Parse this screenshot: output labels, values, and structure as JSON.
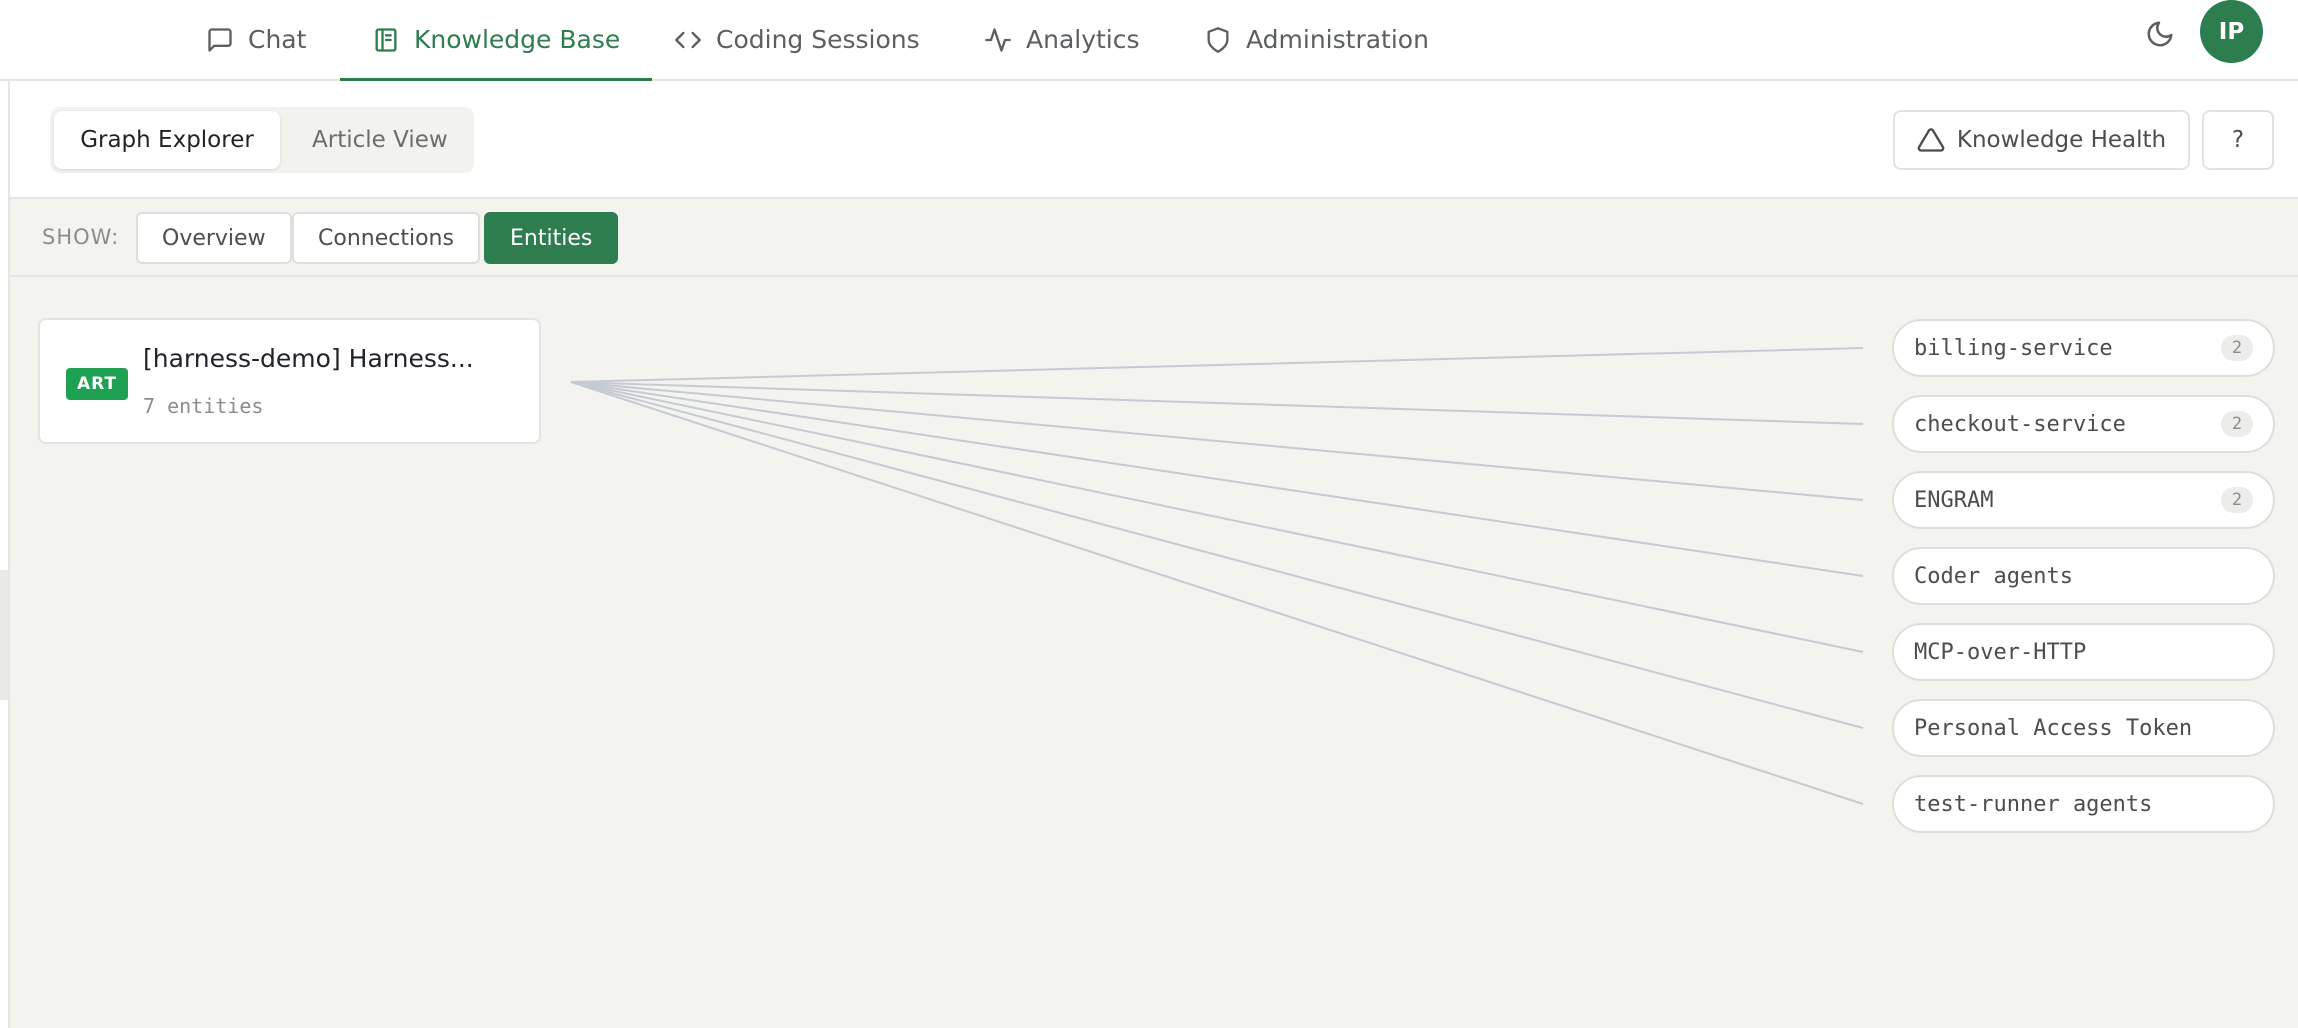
{
  "nav": {
    "tabs": [
      {
        "label": "Chat",
        "icon": "message-square-icon",
        "active": false
      },
      {
        "label": "Knowledge Base",
        "icon": "book-open-icon",
        "active": true
      },
      {
        "label": "Coding Sessions",
        "icon": "code-icon",
        "active": false
      },
      {
        "label": "Analytics",
        "icon": "activity-icon",
        "active": false
      },
      {
        "label": "Administration",
        "icon": "shield-icon",
        "active": false
      }
    ],
    "theme_icon": "moon-icon",
    "avatar_initials": "IP"
  },
  "header": {
    "views": [
      {
        "label": "Graph Explorer",
        "active": true
      },
      {
        "label": "Article View",
        "active": false
      }
    ],
    "health_label": "Knowledge Health",
    "health_icon": "alert-triangle-icon",
    "help_label": "?"
  },
  "show_bar": {
    "label": "SHOW:",
    "filters": [
      {
        "label": "Overview",
        "active": false
      },
      {
        "label": "Connections",
        "active": false
      },
      {
        "label": "Entities",
        "active": true
      }
    ]
  },
  "graph": {
    "article": {
      "badge": "ART",
      "title": "[harness-demo] Harness...",
      "subtitle": "7 entities"
    },
    "entities": [
      {
        "name": "billing-service",
        "count": "2"
      },
      {
        "name": "checkout-service",
        "count": "2"
      },
      {
        "name": "ENGRAM",
        "count": "2"
      },
      {
        "name": "Coder agents",
        "count": ""
      },
      {
        "name": "MCP-over-HTTP",
        "count": ""
      },
      {
        "name": "Personal Access Token",
        "count": ""
      },
      {
        "name": "test-runner agents",
        "count": ""
      }
    ]
  },
  "colors": {
    "accent": "#2e7d4f",
    "badge": "#1fa154",
    "edge": "#c5cad3",
    "canvas": "#f3f3ef"
  }
}
